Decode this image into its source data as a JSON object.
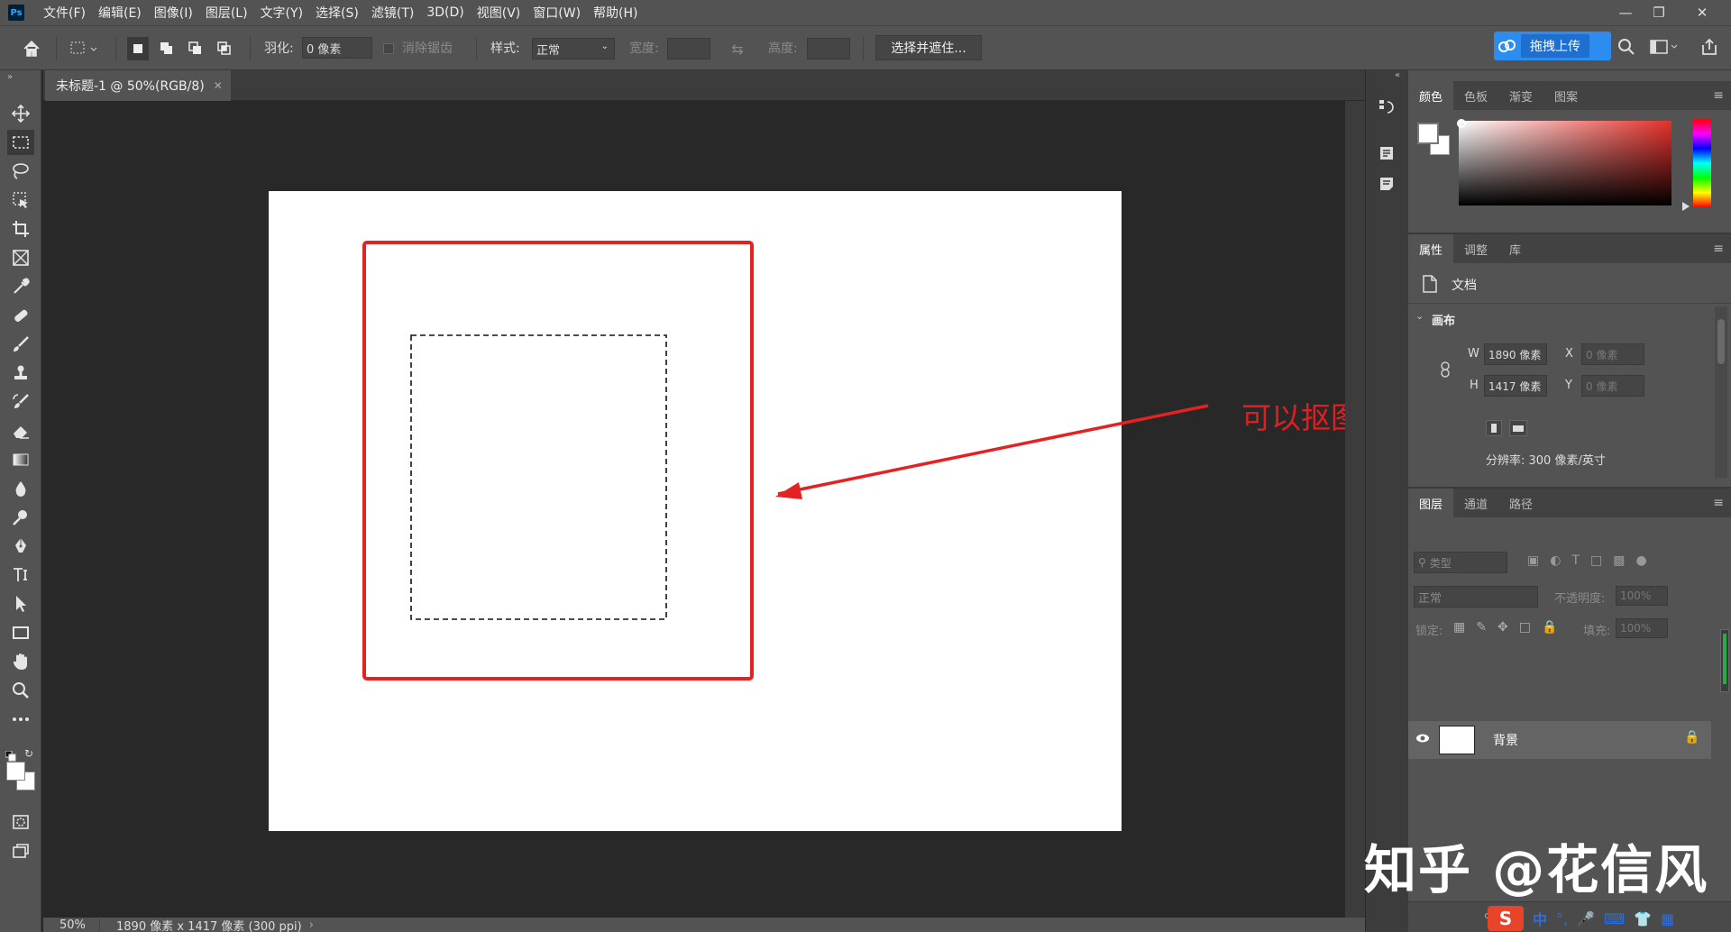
{
  "menubar": {
    "logo": "Ps",
    "items": [
      "文件(F)",
      "编辑(E)",
      "图像(I)",
      "图层(L)",
      "文字(Y)",
      "选择(S)",
      "滤镜(T)",
      "3D(D)",
      "视图(V)",
      "窗口(W)",
      "帮助(H)"
    ]
  },
  "options": {
    "feather_label": "羽化:",
    "feather_value": "0 像素",
    "antialias_label": "消除锯齿",
    "style_label": "样式:",
    "style_value": "正常",
    "width_label": "宽度:",
    "height_label": "高度:",
    "select_mask_button": "选择并遮住...",
    "upload_button": "拖拽上传"
  },
  "document": {
    "tab_title": "未标题-1 @ 50%(RGB/8)",
    "zoom": "50%",
    "status_info": "1890 像素 x 1417 像素 (300 ppi)"
  },
  "annotation": {
    "text": "可以抠图、填充、图层排列顺序"
  },
  "watermark": "知乎 @花信风",
  "color_panel": {
    "tabs": [
      "颜色",
      "色板",
      "渐变",
      "图案"
    ],
    "hue_accent": "#e5312b"
  },
  "properties_panel": {
    "tabs": [
      "属性",
      "调整",
      "库"
    ],
    "doc_label": "文档",
    "canvas_section": "画布",
    "w_label": "W",
    "w_value": "1890 像素",
    "h_label": "H",
    "h_value": "1417 像素",
    "x_label": "X",
    "x_placeholder": "0 像素",
    "y_label": "Y",
    "y_placeholder": "0 像素",
    "resolution": "分辨率: 300 像素/英寸"
  },
  "layers_panel": {
    "tabs": [
      "图层",
      "通道",
      "路径"
    ],
    "filter_placeholder": "类型",
    "blend_mode": "正常",
    "opacity_label": "不透明度:",
    "opacity_value": "100%",
    "lock_label": "锁定:",
    "fill_label": "填充:",
    "fill_value": "100%",
    "layers": [
      {
        "name": "背景"
      }
    ]
  },
  "taskbar": {
    "ime": "中"
  },
  "colors": {
    "annotation_red": "#e02020",
    "panel_bg": "#535353",
    "canvas_bg": "#282828",
    "upload_blue": "#2d8cf0"
  }
}
